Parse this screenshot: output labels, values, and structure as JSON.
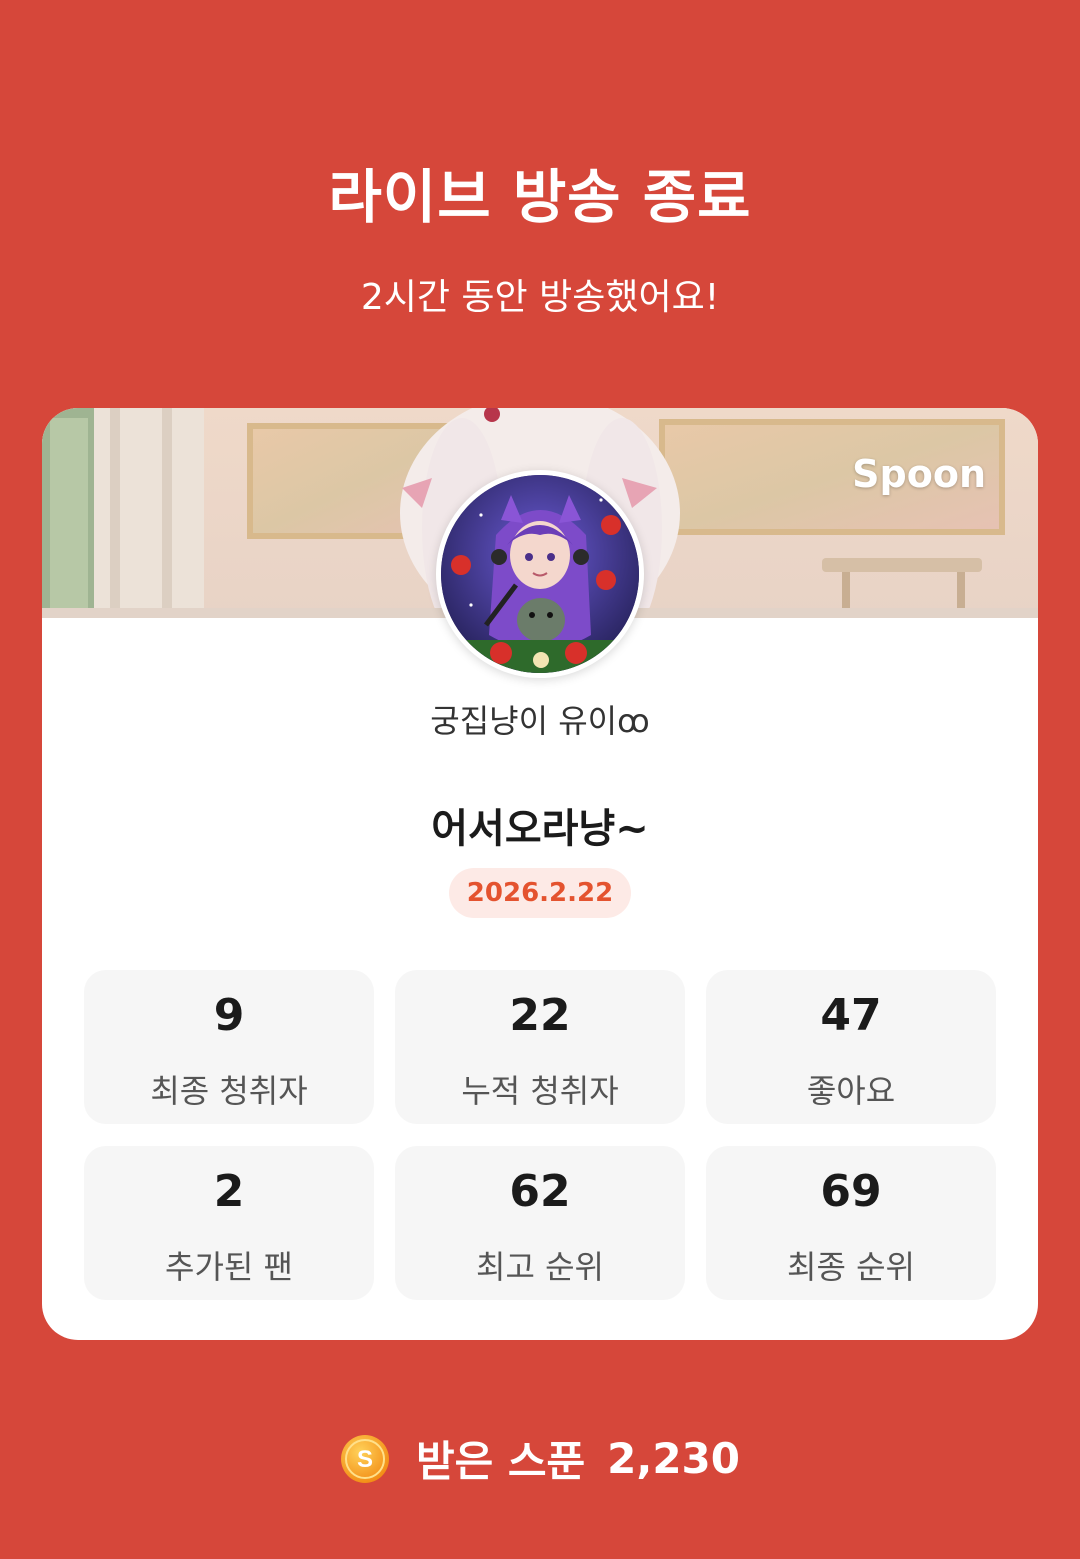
{
  "header": {
    "title": "라이브 방송 종료",
    "subtitle": "2시간 동안 방송했어요!"
  },
  "card": {
    "brand": "Spoon",
    "host_name": "궁집냥이 유이ꝏ",
    "room_title": "어서오라냥~",
    "date": "2026.2.22",
    "stats": [
      {
        "value": "9",
        "label": "최종 청취자"
      },
      {
        "value": "22",
        "label": "누적 청취자"
      },
      {
        "value": "47",
        "label": "좋아요"
      },
      {
        "value": "2",
        "label": "추가된 팬"
      },
      {
        "value": "62",
        "label": "최고 순위"
      },
      {
        "value": "69",
        "label": "최종 순위"
      }
    ]
  },
  "footer": {
    "coin_icon": "spoon-coin-icon",
    "coin_letter": "S",
    "label": "받은 스푼",
    "value": "2,230"
  },
  "colors": {
    "background": "#d6473a",
    "date_text": "#e4532f",
    "date_badge": "#fdeae6",
    "stat_box": "#f6f6f6"
  }
}
